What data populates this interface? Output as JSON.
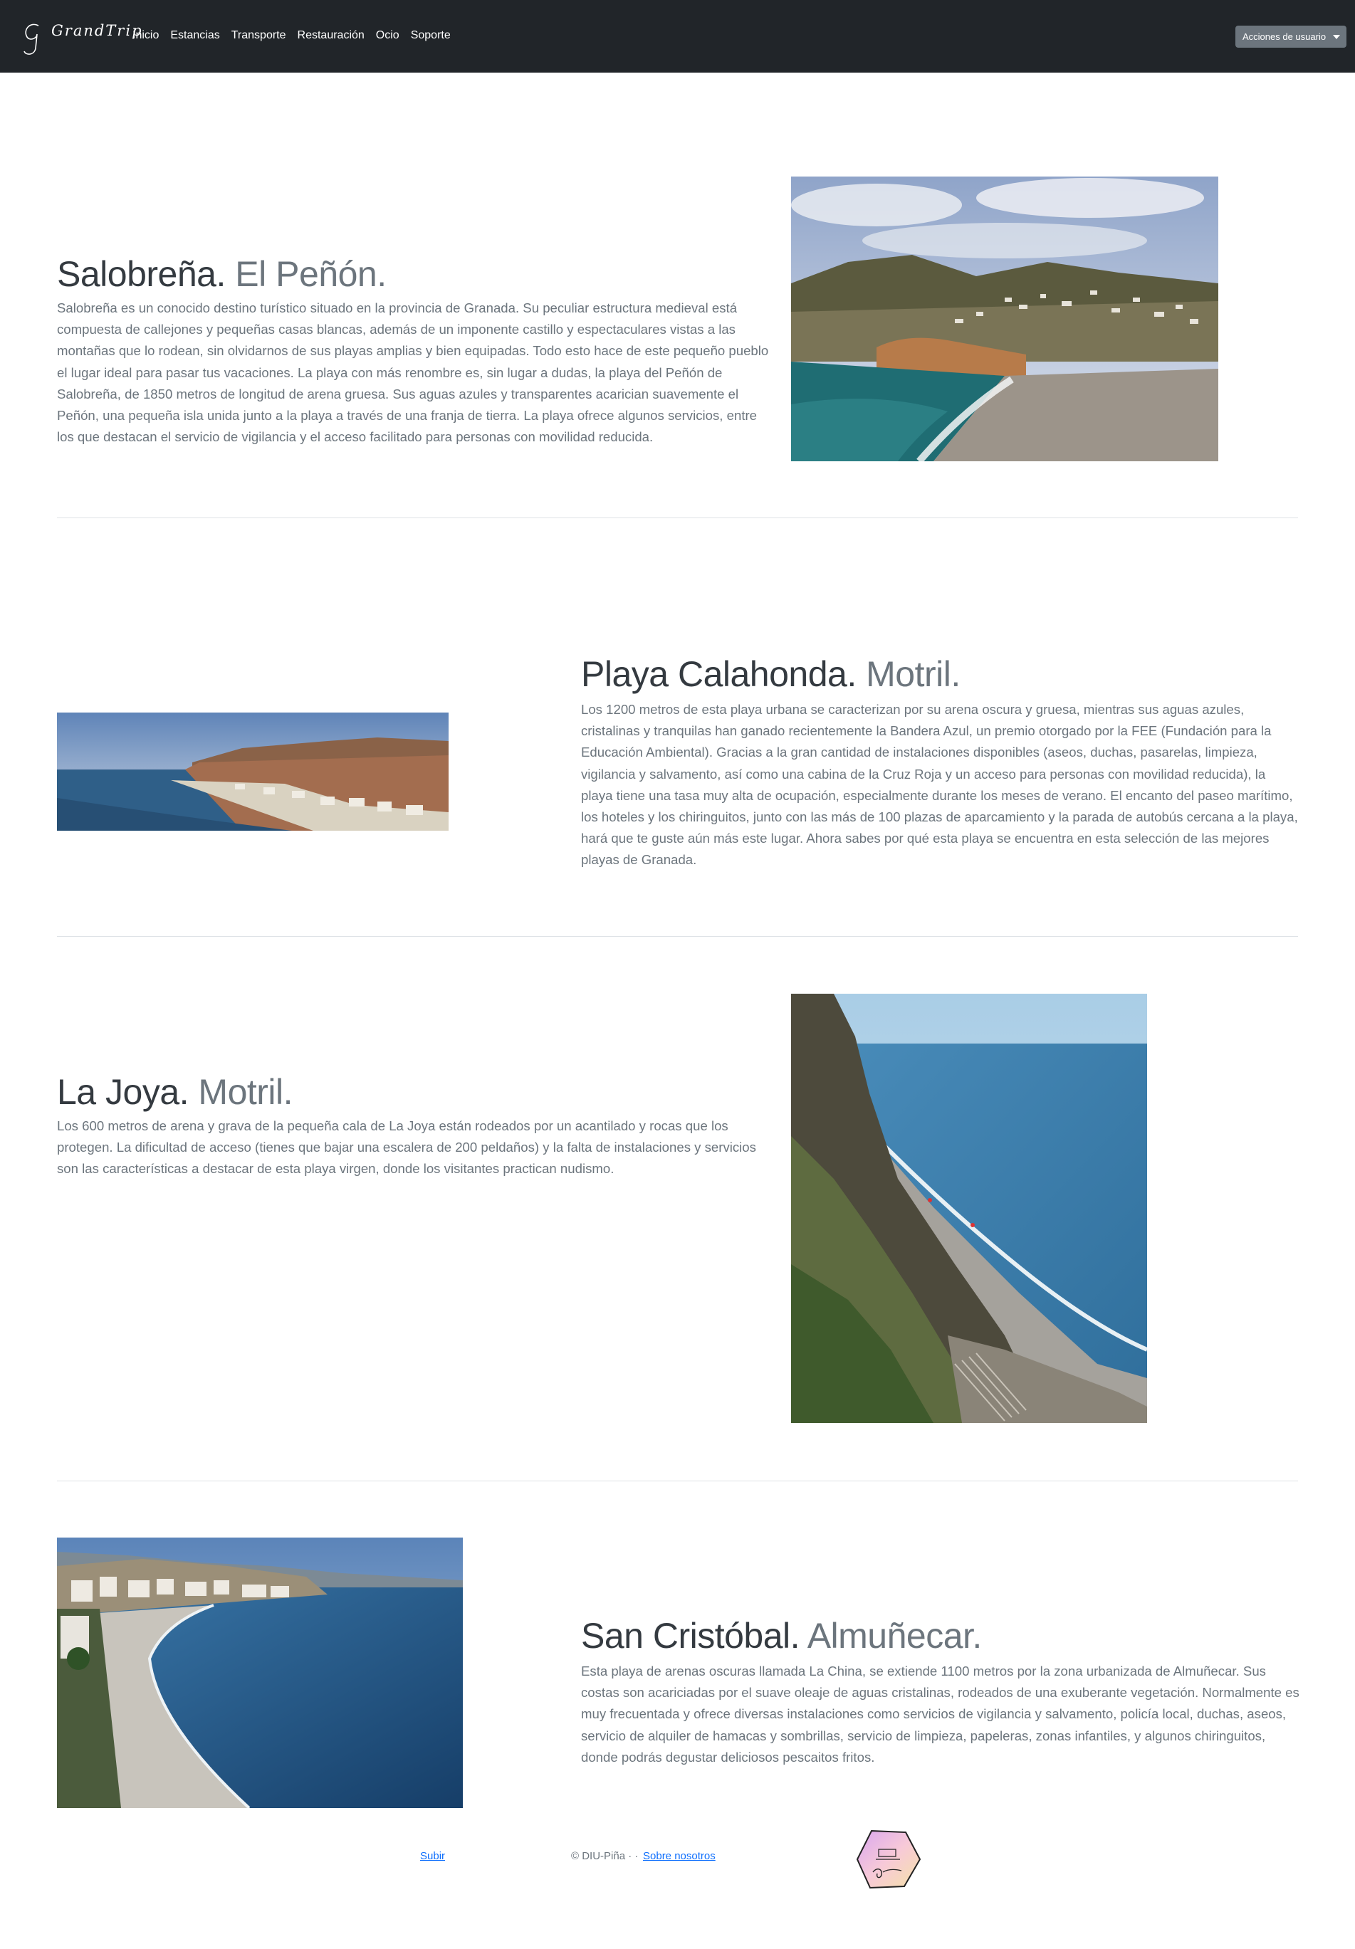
{
  "nav": {
    "brand": "GrandTrip",
    "links": [
      "Inicio",
      "Estancias",
      "Transporte",
      "Restauración",
      "Ocio",
      "Soporte"
    ],
    "user_menu": "Acciones de usuario"
  },
  "sections": [
    {
      "title": "Salobreña.",
      "subtitle": "El Peñón.",
      "text": "Salobreña es un conocido destino turístico situado en la provincia de Granada. Su peculiar estructura medieval está compuesta de callejones y pequeñas casas blancas, además de un imponente castillo y espectaculares vistas a las montañas que lo rodean, sin olvidarnos de sus playas amplias y bien equipadas. Todo esto hace de este pequeño pueblo el lugar ideal para pasar tus vacaciones. La playa con más renombre es, sin lugar a dudas, la playa del Peñón de Salobreña, de 1850 metros de longitud de arena gruesa. Sus aguas azules y transparentes acarician suavemente el Peñón, una pequeña isla unida junto a la playa a través de una franja de tierra. La playa ofrece algunos servicios, entre los que destacan el servicio de vigilancia y el acceso facilitado para personas con movilidad reducida."
    },
    {
      "title": "Playa Calahonda.",
      "subtitle": "Motril.",
      "text": "Los 1200 metros de esta playa urbana se caracterizan por su arena oscura y gruesa, mientras sus aguas azules, cristalinas y tranquilas han ganado recientemente la Bandera Azul, un premio otorgado por la FEE (Fundación para la Educación Ambiental). Gracias a la gran cantidad de instalaciones disponibles (aseos, duchas, pasarelas, limpieza, vigilancia y salvamento, así como una cabina de la Cruz Roja y un acceso para personas con movilidad reducida), la playa tiene una tasa muy alta de ocupación, especialmente durante los meses de verano. El encanto del paseo marítimo, los hoteles y los chiringuitos, junto con las más de 100 plazas de aparcamiento y la parada de autobús cercana a la playa, hará que te guste aún más este lugar. Ahora sabes por qué esta playa se encuentra en esta selección de las mejores playas de Granada."
    },
    {
      "title": "La Joya.",
      "subtitle": "Motril.",
      "text": "Los 600 metros de arena y grava de la pequeña cala de La Joya están rodeados por un acantilado y rocas que los protegen. La dificultad de acceso (tienes que bajar una escalera de 200 peldaños) y la falta de instalaciones y servicios son las características a destacar de esta playa virgen, donde los visitantes practican nudismo."
    },
    {
      "title": "San Cristóbal.",
      "subtitle": "Almuñecar.",
      "text": "Esta playa de arenas oscuras llamada La China, se extiende 1100 metros por la zona urbanizada de Almuñecar. Sus costas son acariciadas por el suave oleaje de aguas cristalinas, rodeados de una exuberante vegetación. Normalmente es muy frecuentada y ofrece diversas instalaciones como servicios de vigilancia y salvamento, policía local, duchas, aseos, servicio de alquiler de hamacas y sombrillas, servicio de limpieza, papeleras, zonas infantiles, y algunos chiringuitos, donde podrás degustar deliciosos pescaitos fritos."
    }
  ],
  "footer": {
    "back_to_top": "Subir",
    "copyright": "© DIU-Piña · ·",
    "about": "Sobre nosotros"
  }
}
